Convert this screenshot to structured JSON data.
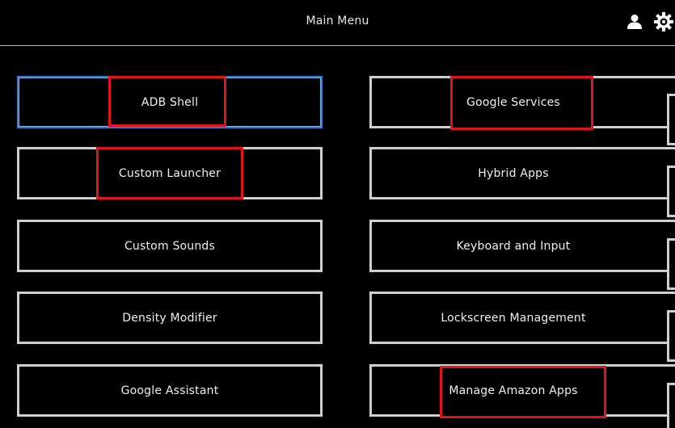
{
  "header": {
    "title": "Main Menu",
    "icons": [
      "user-icon",
      "gear-icon"
    ]
  },
  "left_column": [
    {
      "label": "ADB Shell",
      "focused": true,
      "highlighted": true
    },
    {
      "label": "Custom Launcher",
      "focused": false,
      "highlighted": true
    },
    {
      "label": "Custom Sounds",
      "focused": false,
      "highlighted": false
    },
    {
      "label": "Density Modifier",
      "focused": false,
      "highlighted": false
    },
    {
      "label": "Google Assistant",
      "focused": false,
      "highlighted": false
    }
  ],
  "right_column": [
    {
      "label": "Google Services",
      "focused": false,
      "highlighted": true
    },
    {
      "label": "Hybrid Apps",
      "focused": false,
      "highlighted": false
    },
    {
      "label": "Keyboard and Input",
      "focused": false,
      "highlighted": false
    },
    {
      "label": "Lockscreen Management",
      "focused": false,
      "highlighted": false
    },
    {
      "label": "Manage Amazon Apps",
      "focused": false,
      "highlighted": true
    }
  ],
  "colors": {
    "background": "#000000",
    "tile_border": "#cfcfcf",
    "focus_border": "#2f7fd0",
    "highlight": "#e0141b",
    "text": "#f0f0f0"
  }
}
